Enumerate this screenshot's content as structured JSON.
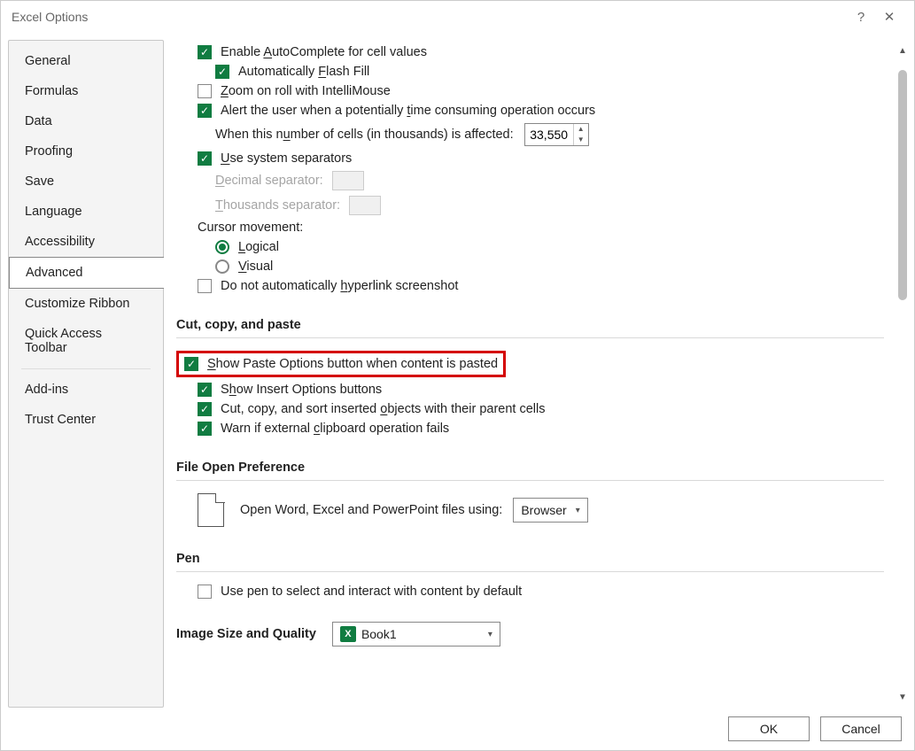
{
  "title": "Excel Options",
  "sidebar": {
    "items": [
      {
        "label": "General"
      },
      {
        "label": "Formulas"
      },
      {
        "label": "Data"
      },
      {
        "label": "Proofing"
      },
      {
        "label": "Save"
      },
      {
        "label": "Language"
      },
      {
        "label": "Accessibility"
      },
      {
        "label": "Advanced",
        "active": true
      },
      {
        "label": "Customize Ribbon"
      },
      {
        "label": "Quick Access Toolbar"
      },
      {
        "sep": true
      },
      {
        "label": "Add-ins"
      },
      {
        "label": "Trust Center"
      }
    ]
  },
  "options": {
    "autocomplete": {
      "checked": true,
      "pre": "Enable ",
      "u": "A",
      "post": "utoComplete for cell values"
    },
    "flashfill": {
      "checked": true,
      "pre": "Automatically ",
      "u": "F",
      "post": "lash Fill"
    },
    "zoom": {
      "checked": false,
      "u": "Z",
      "post": "oom on roll with IntelliMouse"
    },
    "alert_time": {
      "checked": true,
      "pre": "Alert the user when a potentially ",
      "u": "t",
      "post": "ime consuming operation occurs"
    },
    "cells_affected": {
      "pre": "When this n",
      "u": "u",
      "post": "mber of cells (in thousands) is affected:",
      "value": "33,550"
    },
    "sys_sep": {
      "checked": true,
      "u": "U",
      "post": "se system separators"
    },
    "dec_sep": {
      "u": "D",
      "post": "ecimal separator:",
      "value": "."
    },
    "th_sep": {
      "u": "T",
      "post": "housands separator:",
      "value": ","
    },
    "cursor_label": "Cursor movement:",
    "logical": {
      "checked": true,
      "u": "L",
      "post": "ogical"
    },
    "visual": {
      "checked": false,
      "u": "V",
      "post": "isual"
    },
    "no_hyperlink": {
      "checked": false,
      "pre": "Do not automatically ",
      "u": "h",
      "post": "yperlink screenshot"
    }
  },
  "sec_ccp": {
    "title": "Cut, copy, and paste",
    "paste_opts": {
      "checked": true,
      "u": "S",
      "post": "how Paste Options button when content is pasted"
    },
    "insert_opts": {
      "checked": true,
      "pre": "S",
      "u": "h",
      "post": "ow Insert Options buttons"
    },
    "cut_objects": {
      "checked": true,
      "pre": "Cut, copy, and sort inserted ",
      "u": "o",
      "post": "bjects with their parent cells"
    },
    "warn_clip": {
      "checked": true,
      "pre": "Warn if external ",
      "u": "c",
      "post": "lipboard operation fails"
    }
  },
  "sec_file": {
    "title": "File Open Preference",
    "label": "Open Word, Excel and PowerPoint files using:",
    "value": "Browser"
  },
  "sec_pen": {
    "title": "Pen",
    "pen_select": {
      "checked": false,
      "label": "Use pen to select and interact with content by default"
    }
  },
  "sec_img": {
    "title": "Image Size and Quality",
    "value": "Book1"
  },
  "footer": {
    "ok": "OK",
    "cancel": "Cancel"
  }
}
